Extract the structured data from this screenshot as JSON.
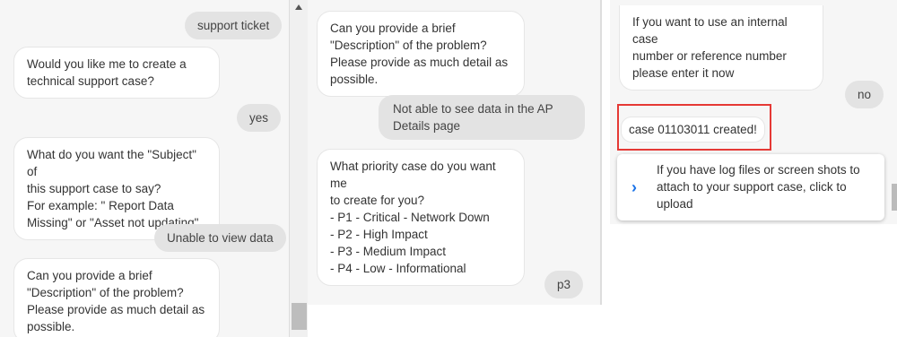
{
  "panel1": {
    "user1": "support ticket",
    "bot1": [
      "Would you like me to create a",
      "technical support case?"
    ],
    "user2": "yes",
    "bot2": [
      "What do you want the \"Subject\" of",
      "this support case to say?",
      "For example: \" Report Data",
      "Missing\" or \"Asset not updating\""
    ],
    "user3": "Unable to view data",
    "bot3": [
      "Can you provide a brief",
      "\"Description\" of the problem?",
      "Please provide as much detail as",
      "possible."
    ]
  },
  "panel2": {
    "bot1": [
      "Can you provide a brief",
      "\"Description\" of the problem?",
      "Please provide as much detail as",
      "possible."
    ],
    "user1": [
      "Not able to see data in the AP",
      "Details page"
    ],
    "bot2": [
      "What priority case do you want me",
      "to create for you?",
      "- P1 - Critical - Network Down",
      "- P2 - High Impact",
      "- P3 - Medium Impact",
      "- P4 - Low - Informational"
    ],
    "user2": "p3"
  },
  "panel3": {
    "bot1": [
      "If you want to use an internal case",
      "number or reference number",
      "please enter it now"
    ],
    "user1": "no",
    "case_created": "case 01103011 created!",
    "upload_card": [
      "If you have log files or screen shots to",
      "attach to your support case, click to",
      "upload"
    ]
  },
  "icons": {
    "chevron": "chevron-right-icon",
    "scroll_up": "scroll-up-arrow-icon"
  },
  "colors": {
    "highlight": "#e53935",
    "accent": "#1a73e8"
  }
}
